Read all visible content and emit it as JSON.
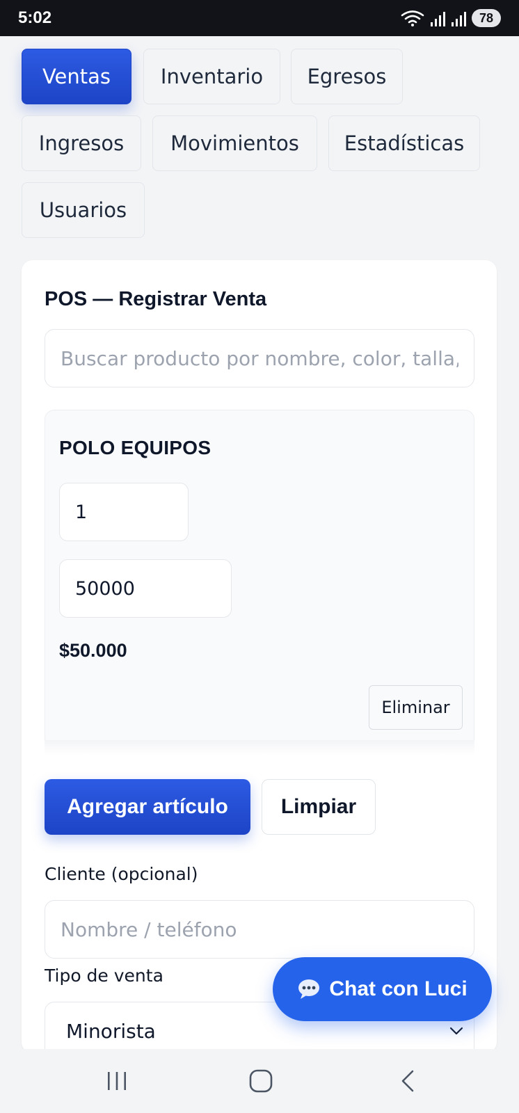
{
  "status_bar": {
    "time": "5:02",
    "battery": "78",
    "icons": [
      "wifi-icon",
      "signal-icon",
      "signal-icon"
    ]
  },
  "tabs": [
    {
      "label": "Ventas",
      "active": true
    },
    {
      "label": "Inventario",
      "active": false
    },
    {
      "label": "Egresos",
      "active": false
    },
    {
      "label": "Ingresos",
      "active": false
    },
    {
      "label": "Movimientos",
      "active": false
    },
    {
      "label": "Estadísticas",
      "active": false
    },
    {
      "label": "Usuarios",
      "active": false
    }
  ],
  "pos": {
    "title": "POS — Registrar Venta",
    "search_placeholder": "Buscar producto por nombre, color, talla, código…",
    "item": {
      "name": "POLO EQUIPOS",
      "quantity": "1",
      "price": "50000",
      "total": "$50.000",
      "delete_label": "Eliminar"
    },
    "add_label": "Agregar artículo",
    "clear_label": "Limpiar",
    "client_label": "Cliente (opcional)",
    "client_placeholder": "Nombre / teléfono",
    "type_label": "Tipo de venta",
    "type_value": "Minorista"
  },
  "chat": {
    "label": "Chat con Luci",
    "icon": "chat-bubble-icon"
  },
  "nav": {
    "icons": [
      "recent-apps-icon",
      "home-icon",
      "back-icon"
    ]
  },
  "colors": {
    "accent": "#2563eb",
    "accent_dark": "#1d44c6",
    "background": "#f3f4f6",
    "text": "#0f172a"
  }
}
